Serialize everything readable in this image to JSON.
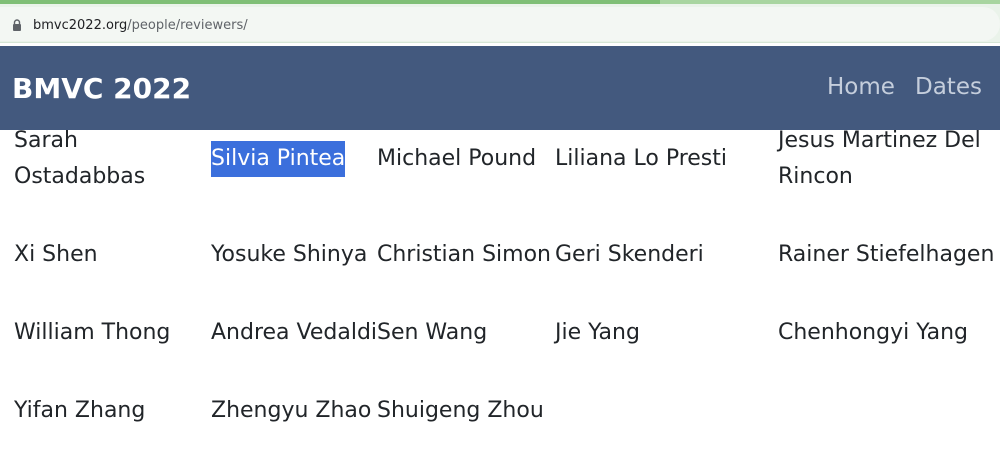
{
  "browser": {
    "url_domain": "bmvc2022.org",
    "url_path": "/people/reviewers/"
  },
  "navbar": {
    "brand": "BMVC 2022",
    "links": [
      "Home",
      "Dates"
    ]
  },
  "reviewers": {
    "rows": [
      [
        "Sarah Ostadabbas",
        "Silvia Pintea",
        "Michael Pound",
        "Liliana Lo Presti",
        "Jesus Martinez Del Rincon"
      ],
      [
        "Xi Shen",
        "Yosuke Shinya",
        "Christian Simon",
        "Geri Skenderi",
        "Rainer Stiefelhagen"
      ],
      [
        "William Thong",
        "Andrea Vedaldi",
        "Sen Wang",
        "Jie Yang",
        "Chenhongyi Yang"
      ],
      [
        "Yifan Zhang",
        "Zhengyu Zhao",
        "Shuigeng Zhou"
      ]
    ],
    "selected_name": "Silvia Pintea"
  }
}
